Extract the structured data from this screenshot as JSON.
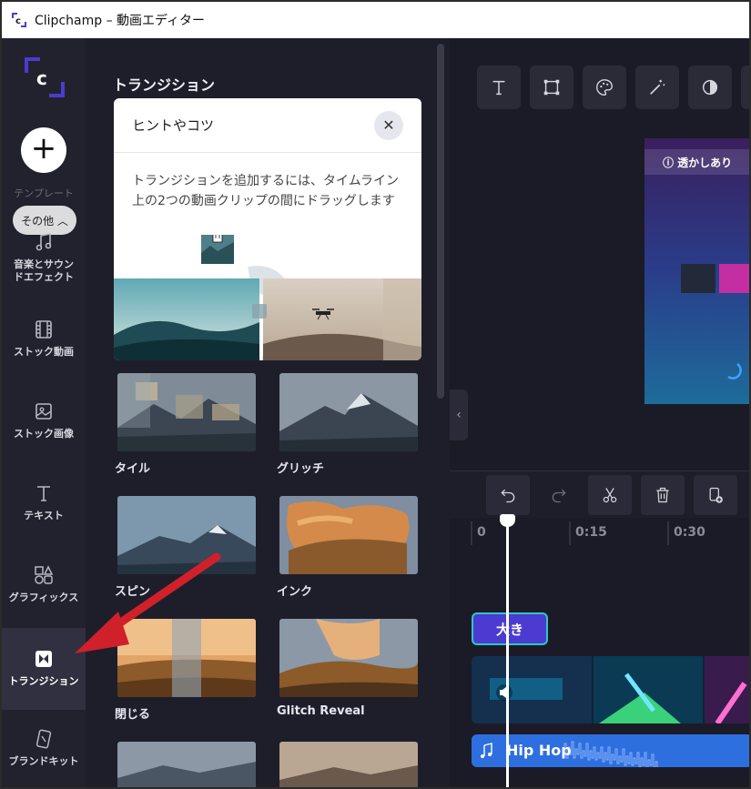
{
  "window": {
    "title": "Clipchamp – 動画エディター"
  },
  "sidebar": {
    "add_symbol": "+",
    "template_label": "テンプレート",
    "more_label": "その他 ︿",
    "items": [
      {
        "label": "音楽とサウンドエフェクト",
        "icon": "music-note-icon"
      },
      {
        "label": "ストック動画",
        "icon": "film-icon"
      },
      {
        "label": "ストック画像",
        "icon": "image-icon"
      },
      {
        "label": "テキスト",
        "icon": "text-icon"
      },
      {
        "label": "グラフィックス",
        "icon": "shapes-icon"
      },
      {
        "label": "トランジション",
        "icon": "transition-icon"
      },
      {
        "label": "ブランドキット",
        "icon": "brand-kit-icon"
      }
    ]
  },
  "panel": {
    "title": "トランジション",
    "tips": {
      "title": "ヒントやコツ",
      "close": "✕",
      "body_line1": "トランジションを追加するには、タイムライン",
      "body_line2": "上の2つの動画クリップの間にドラッグします"
    },
    "transitions": [
      {
        "label": "タイル"
      },
      {
        "label": "グリッチ"
      },
      {
        "label": "スピン"
      },
      {
        "label": "インク"
      },
      {
        "label": "閉じる"
      },
      {
        "label": "Glitch Reveal"
      }
    ],
    "collapse": "‹"
  },
  "preview": {
    "watermark": "ⓘ 透かしあり"
  },
  "timeline": {
    "ticks": [
      "0",
      "0:15",
      "0:30"
    ],
    "text_clip": "大き",
    "audio_clip": "Hip Hop"
  },
  "colors": {
    "accent": "#4b3bd0",
    "audio": "#2e6fe0",
    "arrow": "#d0202a"
  }
}
